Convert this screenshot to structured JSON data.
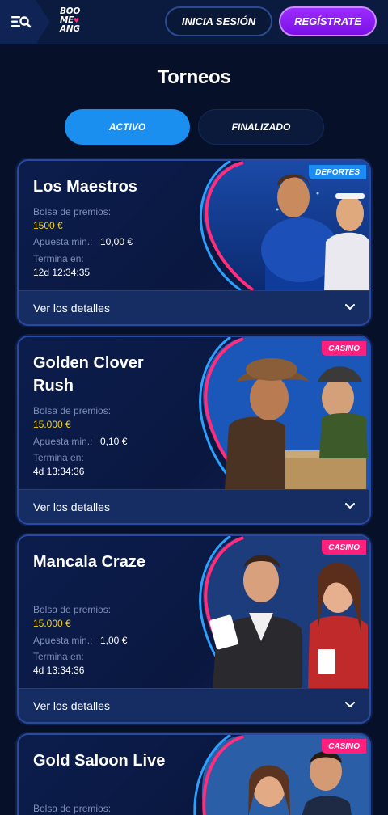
{
  "header": {
    "logo": {
      "line1": "BOO",
      "line2": "ME",
      "line3": "ANG"
    },
    "login_label": "INICIA SESIÓN",
    "register_label": "REGÍSTRATE"
  },
  "page": {
    "title": "Torneos",
    "tabs": [
      {
        "label": "ACTIVO",
        "active": true
      },
      {
        "label": "FINALIZADO",
        "active": false
      }
    ]
  },
  "labels": {
    "prize_pool": "Bolsa de premios:",
    "min_bet": "Apuesta min.:",
    "ends_in": "Termina en:",
    "details": "Ver los detalles"
  },
  "tournaments": [
    {
      "name": "Los Maestros",
      "category": "DEPORTES",
      "prize": "1500 €",
      "min_bet": "10,00 €",
      "ends": "12d 12:34:35"
    },
    {
      "name": "Golden Clover Rush",
      "category": "CASINO",
      "prize": "15.000 €",
      "min_bet": "0,10 €",
      "ends": "4d 13:34:36"
    },
    {
      "name": "Mancala Craze",
      "category": "CASINO",
      "prize": "15.000 €",
      "min_bet": "1,00 €",
      "ends": "4d 13:34:36"
    },
    {
      "name": "Gold Saloon Live",
      "category": "CASINO",
      "prize": "",
      "min_bet": "",
      "ends": ""
    }
  ],
  "colors": {
    "accent": "#1a8ff0",
    "register": "#8a1ff5",
    "prize": "#f7d21c",
    "badge_sports": "#1c8bf2",
    "badge_casino": "#ff1f7d"
  }
}
